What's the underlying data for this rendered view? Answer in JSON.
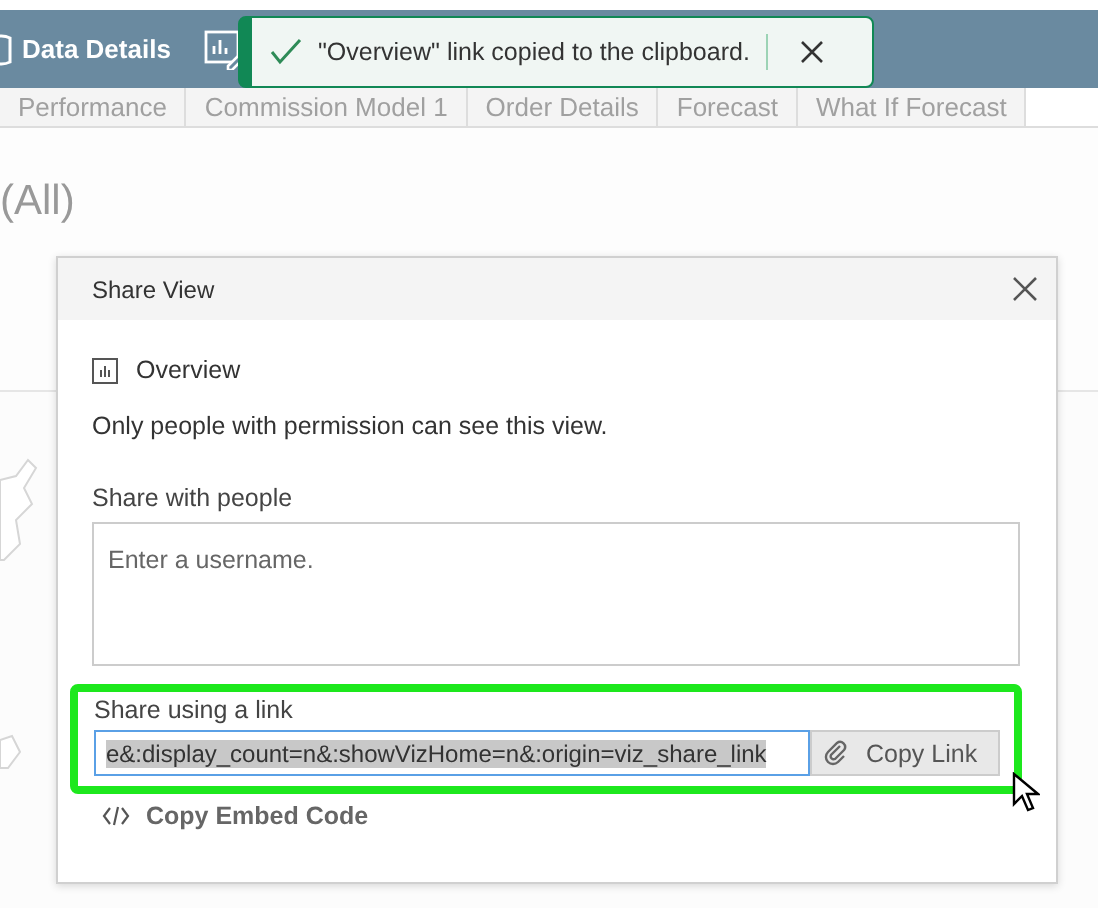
{
  "toolbar": {
    "title": "Data Details"
  },
  "tabs": [
    {
      "label": "Performance"
    },
    {
      "label": "Commission Model 1"
    },
    {
      "label": "Order Details"
    },
    {
      "label": "Forecast"
    },
    {
      "label": "What If Forecast"
    }
  ],
  "filter_value": "(All)",
  "toast": {
    "message": "\"Overview\" link copied to the clipboard."
  },
  "dialog": {
    "title": "Share View",
    "view_name": "Overview",
    "permission_note": "Only people with permission can see this view.",
    "share_people": {
      "label": "Share with people",
      "placeholder": "Enter a username."
    },
    "share_link": {
      "label": "Share using a link",
      "value": "e&:display_count=n&:showVizHome=n&:origin=viz_share_link",
      "button": "Copy Link"
    },
    "embed_link": "Copy Embed Code"
  }
}
